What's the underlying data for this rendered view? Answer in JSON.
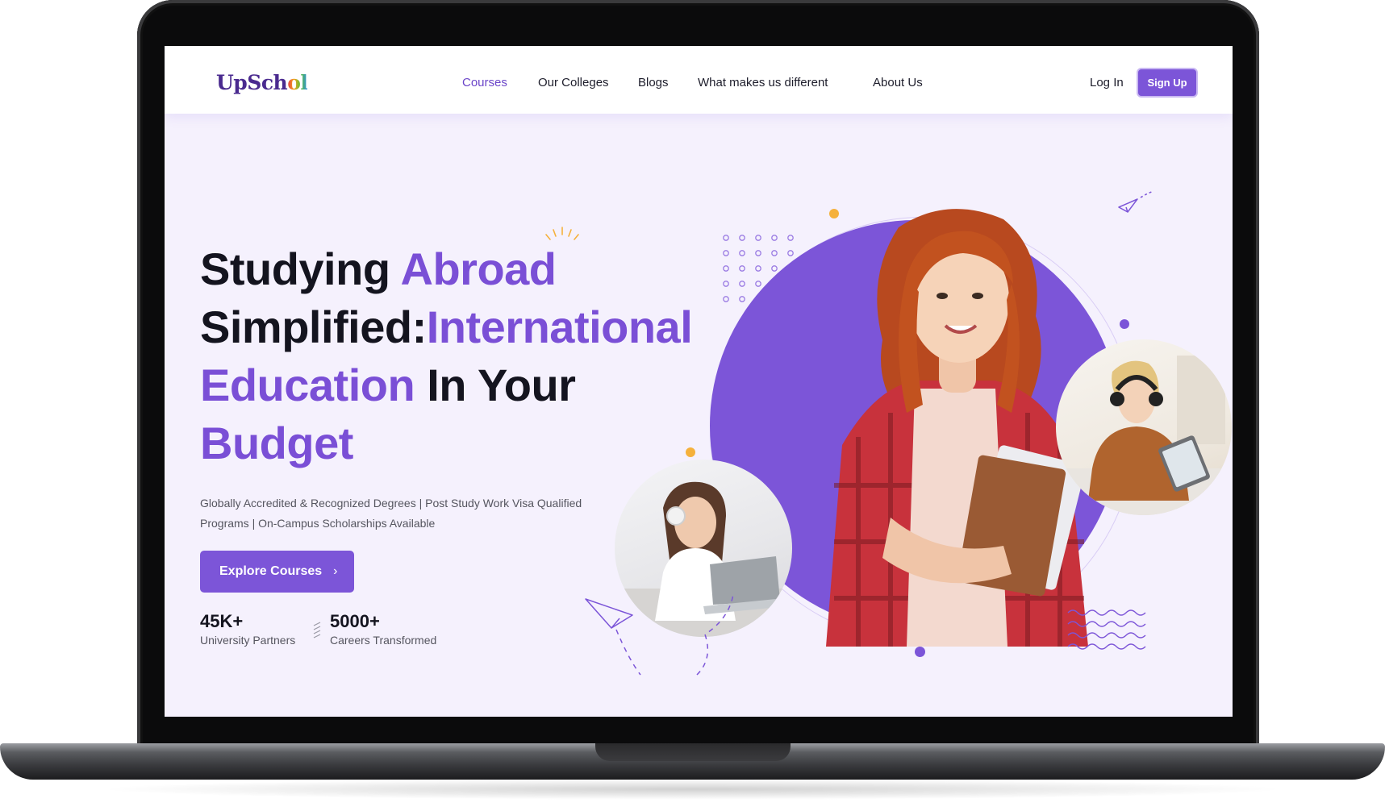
{
  "logo": {
    "prefix": "UpSch",
    "suffix": "ol"
  },
  "nav": {
    "items": [
      {
        "label": "Courses",
        "active": true
      },
      {
        "label": "Our Colleges",
        "active": false
      },
      {
        "label": "Blogs",
        "active": false
      },
      {
        "label": "What makes us different",
        "active": false
      },
      {
        "label": "About Us",
        "active": false
      }
    ],
    "login_label": "Log In",
    "signup_label": "Sign Up"
  },
  "hero": {
    "title_part1": "Studying ",
    "title_part2": "Abroad",
    "title_part3": "Simplified:",
    "title_part4": "International",
    "title_part5": "Education",
    "title_part6": " In Your",
    "title_part7": "Budget",
    "subtitle": "Globally Accredited & Recognized Degrees | Post Study Work Visa Qualified Programs | On-Campus Scholarships Available",
    "cta_label": "Explore Courses",
    "cta_icon": "chevron-right-icon"
  },
  "stats": [
    {
      "value": "45K+",
      "label": "University Partners"
    },
    {
      "value": "5000+",
      "label": "Careers Transformed"
    }
  ],
  "colors": {
    "accent": "#7c55d8",
    "heading": "#14141f",
    "background": "#f5f1fd",
    "dot_orange": "#f5b13c",
    "dot_purple": "#7c55d8"
  }
}
